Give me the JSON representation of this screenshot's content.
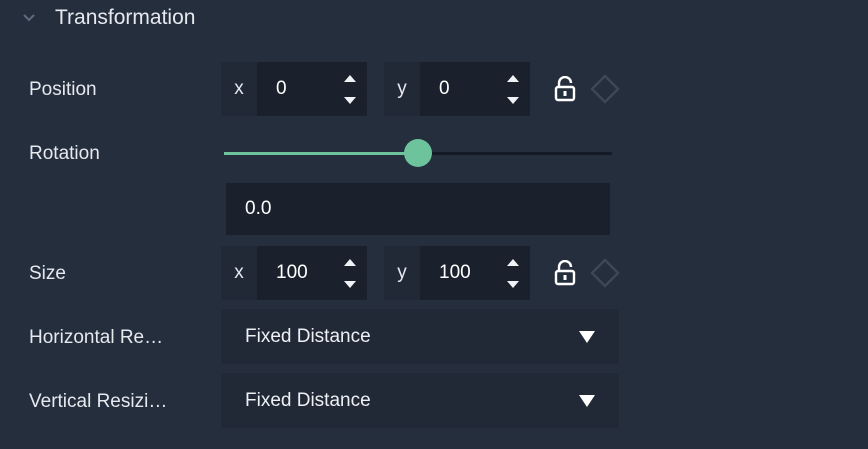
{
  "section": {
    "title": "Transformation",
    "collapse_icon": "chevron-down-icon"
  },
  "position": {
    "label": "Position",
    "x_axis": "x",
    "x_value": "0",
    "y_axis": "y",
    "y_value": "0",
    "lock_icon": "unlock-icon",
    "link_icon": "link-diamond-icon"
  },
  "rotation": {
    "label": "Rotation",
    "value": "0.0",
    "slider_fraction": 0.5
  },
  "size": {
    "label": "Size",
    "x_axis": "x",
    "x_value": "100",
    "y_axis": "y",
    "y_value": "100",
    "lock_icon": "unlock-icon",
    "link_icon": "link-diamond-icon"
  },
  "horizontal_resizing": {
    "label": "Horizontal Re…",
    "value": "Fixed Distance"
  },
  "vertical_resizing": {
    "label": "Vertical Resizi…",
    "value": "Fixed Distance"
  },
  "colors": {
    "background": "#252e3d",
    "field": "#1b212c",
    "accent": "#6cc39c"
  }
}
